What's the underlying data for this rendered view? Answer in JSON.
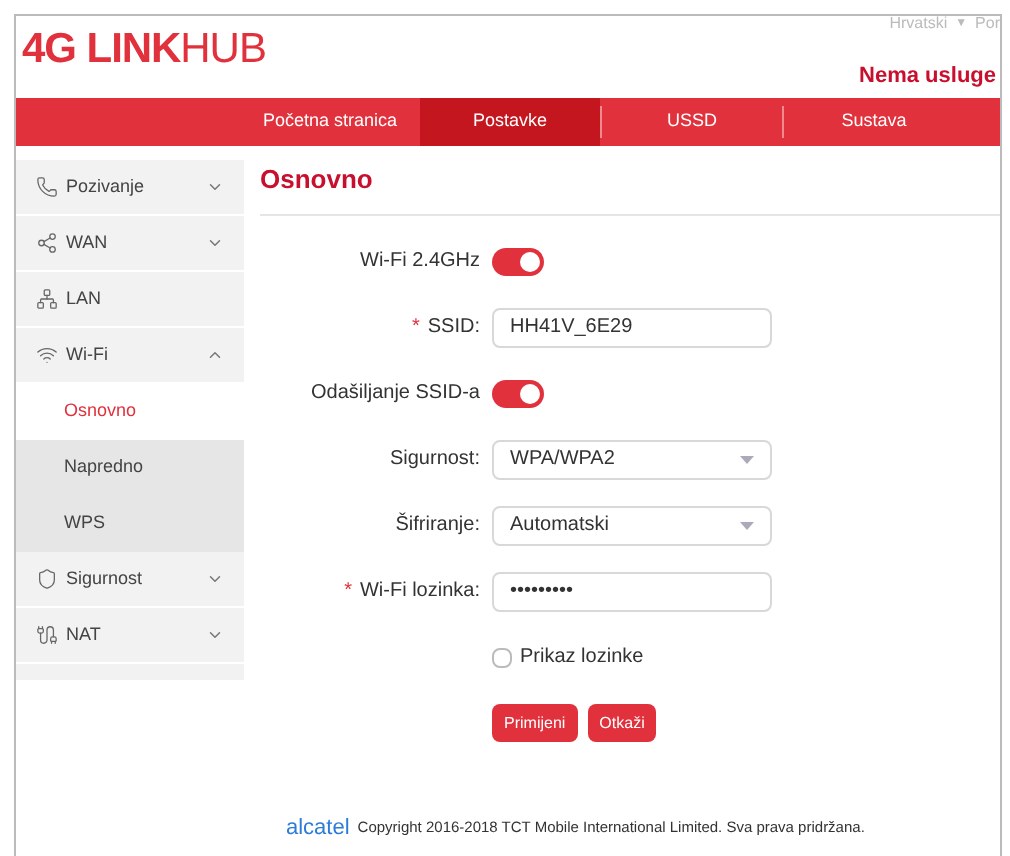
{
  "header": {
    "logo_bold": "4G LINK",
    "logo_light": "HUB",
    "language": "Hrvatski",
    "language_caret": "▼",
    "cut_link": "Por",
    "status": "Nema usluge"
  },
  "tabs": [
    {
      "label": "Početna stranica",
      "selected": false
    },
    {
      "label": "Postavke",
      "selected": true
    },
    {
      "label": "USSD",
      "selected": false
    },
    {
      "label": "Sustava",
      "selected": false
    }
  ],
  "sidebar": {
    "items": [
      {
        "label": "Pozivanje",
        "expanded": false
      },
      {
        "label": "WAN",
        "expanded": false
      },
      {
        "label": "LAN"
      },
      {
        "label": "Wi-Fi",
        "expanded": true,
        "children": [
          {
            "label": "Osnovno",
            "selected": true
          },
          {
            "label": "Napredno",
            "selected": false
          },
          {
            "label": "WPS",
            "selected": false
          }
        ]
      },
      {
        "label": "Sigurnost",
        "expanded": false
      },
      {
        "label": "NAT",
        "expanded": false
      }
    ]
  },
  "content": {
    "title": "Osnovno",
    "fields": [
      {
        "kind": "toggle",
        "label": "Wi-Fi 2.4GHz",
        "on": true
      },
      {
        "kind": "text",
        "label": "SSID:",
        "mark": "*",
        "value": "HH41V_6E29"
      },
      {
        "kind": "toggle",
        "label": "Odašiljanje SSID-a",
        "on": true
      },
      {
        "kind": "select",
        "label": "Sigurnost:",
        "value": "WPA/WPA2"
      },
      {
        "kind": "select",
        "label": "Šifriranje:",
        "value": "Automatski"
      },
      {
        "kind": "password",
        "label": "Wi-Fi lozinka:",
        "mark": "*",
        "value": "•••••••••"
      },
      {
        "kind": "checkbox",
        "label": "Prikaz lozinke",
        "checked": false
      }
    ],
    "buttons": [
      "Primijeni",
      "Otkaži"
    ]
  },
  "footer": {
    "brand": "alcatel",
    "text": "Copyright 2016-2018 TCT Mobile International Limited. Sva prava pridržana."
  }
}
